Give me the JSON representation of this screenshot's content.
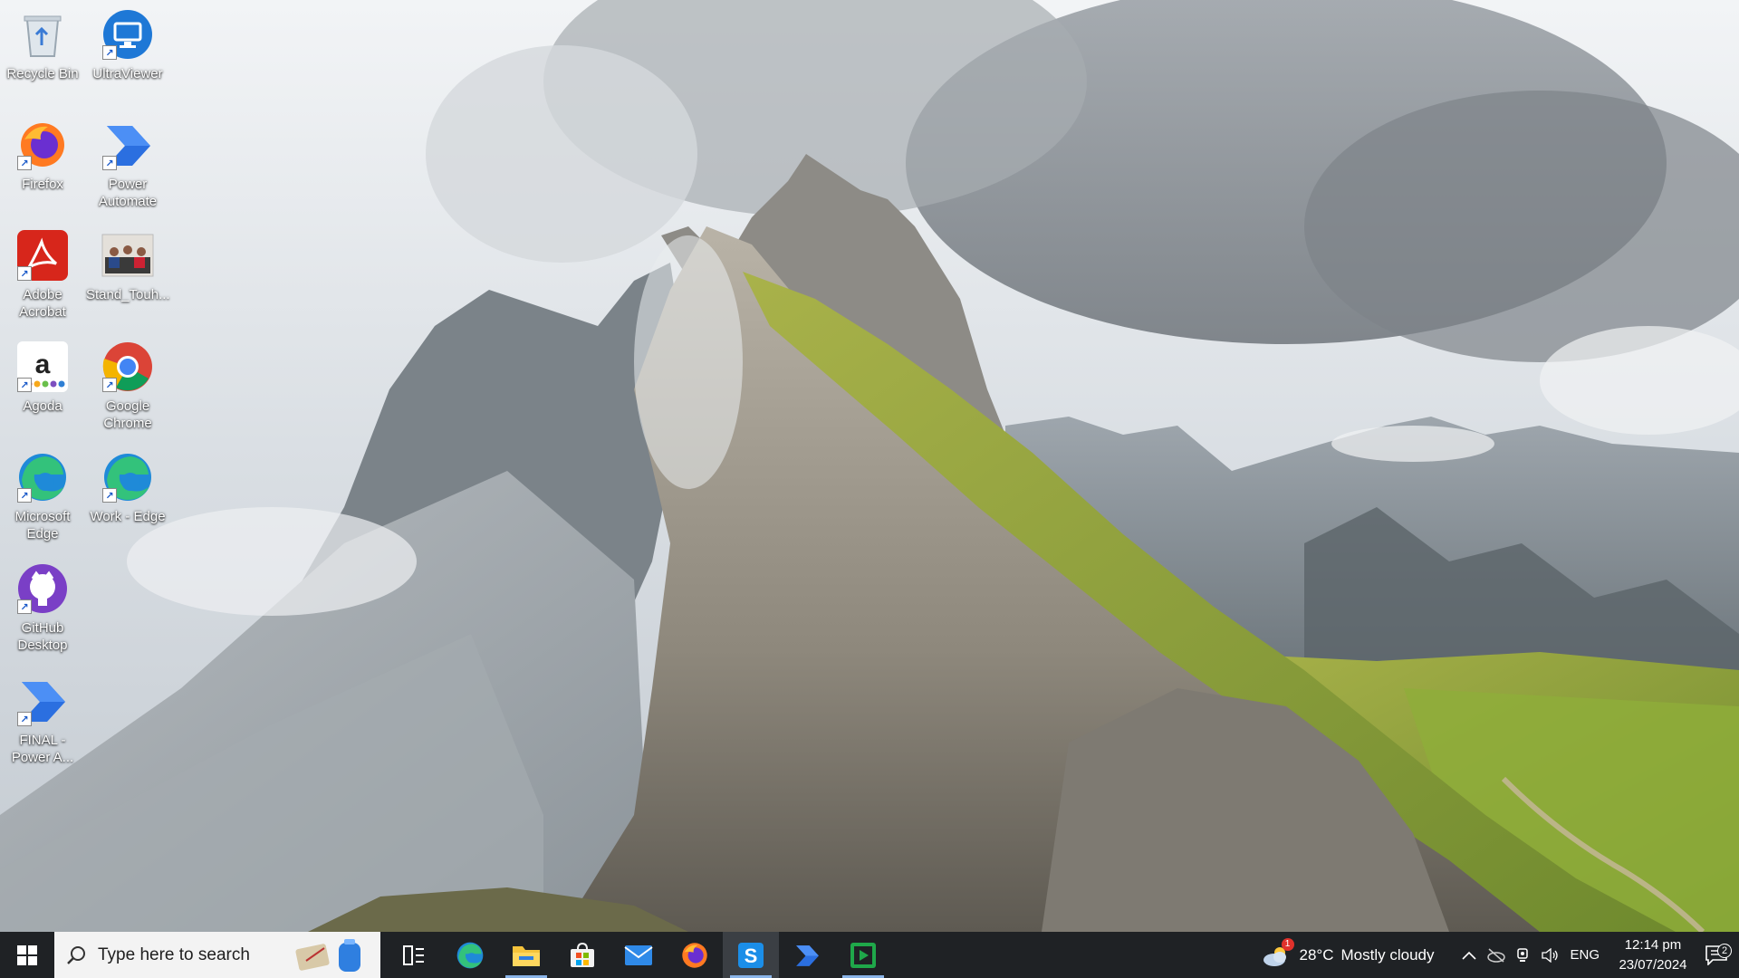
{
  "desktop": {
    "icons": [
      {
        "label": "Recycle Bin",
        "icon": "recycle-bin-icon"
      },
      {
        "label": "UltraViewer",
        "icon": "ultraviewer-icon"
      },
      {
        "label": "Firefox",
        "icon": "firefox-icon"
      },
      {
        "label": "Power Automate",
        "icon": "power-automate-icon"
      },
      {
        "label": "Adobe Acrobat",
        "icon": "adobe-acrobat-icon"
      },
      {
        "label": "Stand_Touh...",
        "icon": "image-file-icon"
      },
      {
        "label": "Agoda",
        "icon": "agoda-icon"
      },
      {
        "label": "Google Chrome",
        "icon": "chrome-icon"
      },
      {
        "label": "Microsoft Edge",
        "icon": "edge-icon"
      },
      {
        "label": "Work - Edge",
        "icon": "edge-icon"
      },
      {
        "label": "GitHub Desktop",
        "icon": "github-icon"
      },
      {
        "label": "FINAL - Power A...",
        "icon": "power-automate-icon"
      }
    ]
  },
  "taskbar": {
    "search_placeholder": "Type here to search",
    "apps": [
      {
        "name": "Task View",
        "icon": "task-view-icon"
      },
      {
        "name": "Microsoft Edge",
        "icon": "edge-icon"
      },
      {
        "name": "File Explorer",
        "icon": "file-explorer-icon"
      },
      {
        "name": "Microsoft Store",
        "icon": "store-icon"
      },
      {
        "name": "Mail",
        "icon": "mail-icon"
      },
      {
        "name": "Firefox",
        "icon": "firefox-icon"
      },
      {
        "name": "Screen app",
        "icon": "s-app-icon"
      },
      {
        "name": "Power Automate",
        "icon": "power-automate-icon"
      },
      {
        "name": "Media app",
        "icon": "play-app-icon"
      }
    ],
    "weather": {
      "temp": "28°C",
      "desc": "Mostly cloudy",
      "alert_count": "1"
    },
    "language": "ENG",
    "time": "12:14 pm",
    "date": "23/07/2024",
    "notification_count": "2"
  }
}
